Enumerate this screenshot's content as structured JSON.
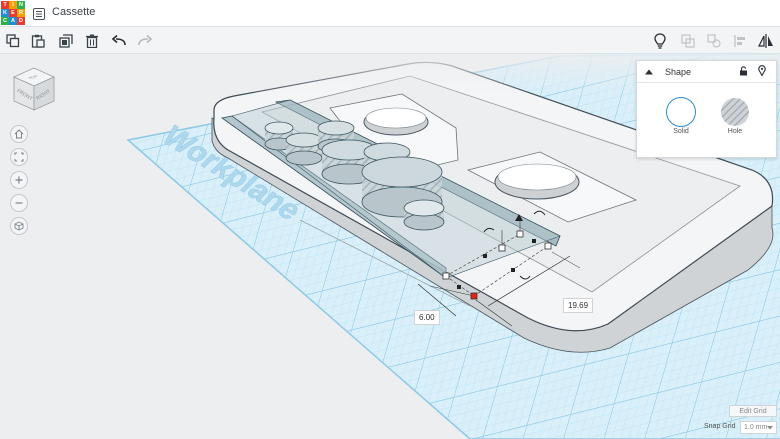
{
  "app": {
    "logo_letters": [
      "T",
      "I",
      "N",
      "K",
      "E",
      "R",
      "C",
      "A",
      "D"
    ],
    "logo_colors": [
      "#e63b2e",
      "#f2a100",
      "#2fb04a",
      "#1a8fd6",
      "#e63b2e",
      "#f2a100",
      "#2fb04a",
      "#1a8fd6",
      "#e63b2e"
    ],
    "project_title": "Cassette"
  },
  "toolbar": {
    "left_tools": [
      "copy-icon",
      "paste-icon",
      "duplicate-icon",
      "delete-icon",
      "undo-icon",
      "redo-icon"
    ],
    "right_tools": [
      "light-bulb-icon",
      "group-icon",
      "ungroup-icon",
      "align-icon",
      "mirror-icon"
    ]
  },
  "view_cube": {
    "faces": [
      "TOP",
      "FRONT",
      "RIGHT"
    ]
  },
  "nav_controls": [
    "home-view-icon",
    "fit-view-icon",
    "zoom-in-icon",
    "zoom-out-icon",
    "perspective-icon"
  ],
  "workplane": {
    "label": "Workplane",
    "grid_color": "#a8d8f0"
  },
  "shape_panel": {
    "title": "Shape",
    "solid_label": "Solid",
    "hole_label": "Hole",
    "solid_color": "#2f88d3"
  },
  "dimensions": {
    "width_value": "6.00",
    "length_value": "19.69"
  },
  "footer": {
    "edit_grid_label": "Edit Grid",
    "snap_grid_label": "Snap Grid",
    "snap_grid_value": "1.0 mm"
  }
}
